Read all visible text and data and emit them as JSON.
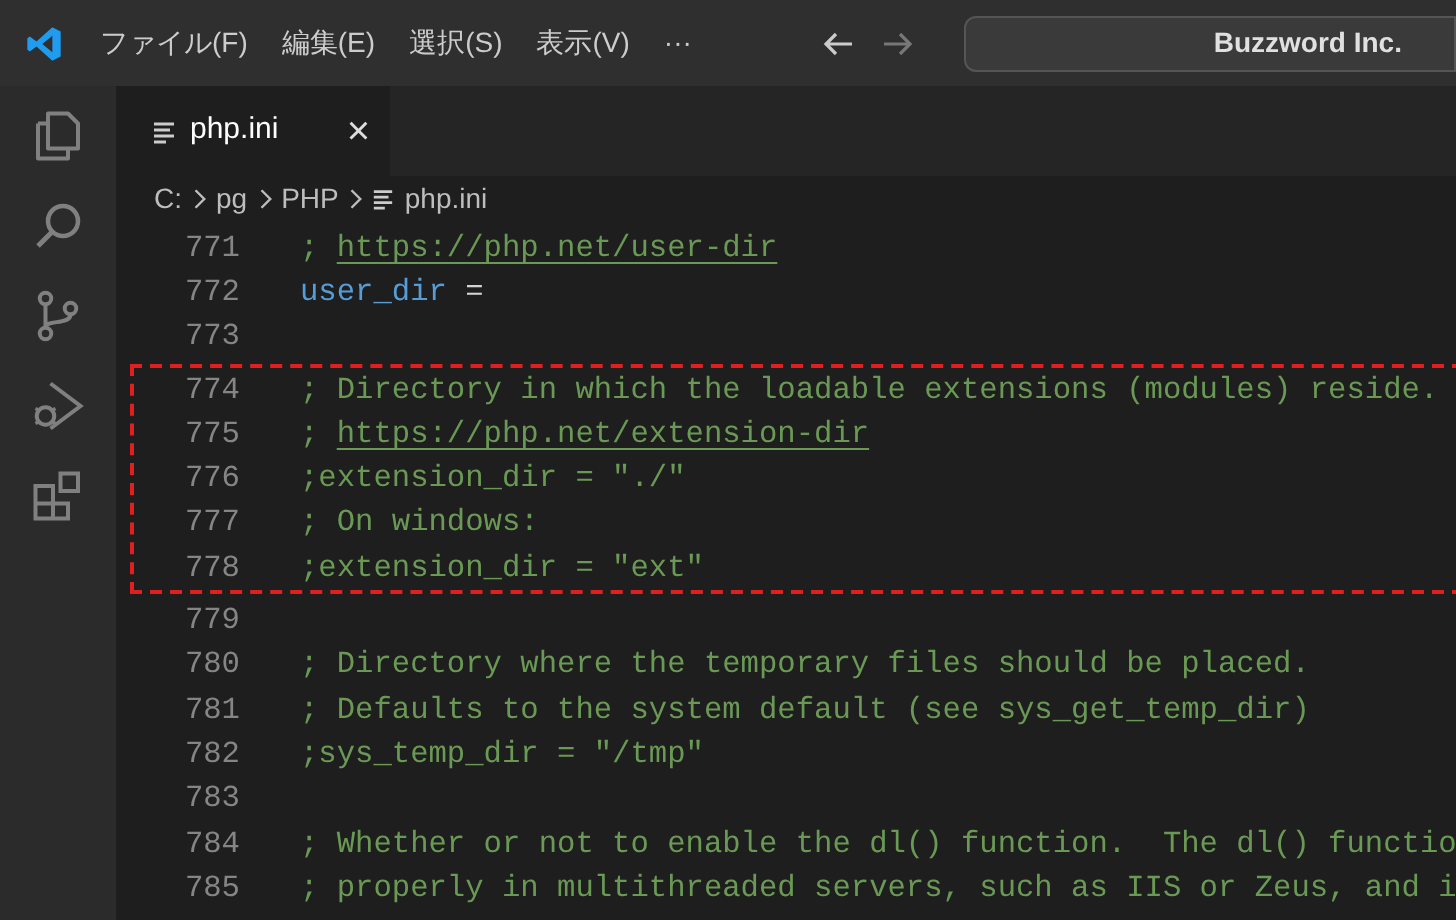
{
  "title_bar": {
    "menus": [
      "ファイル(F)",
      "編集(E)",
      "選択(S)",
      "表示(V)",
      "···"
    ],
    "search": {
      "value": "Buzzword Inc."
    }
  },
  "activity_bar": [
    {
      "kind": "files",
      "selected": false
    },
    {
      "kind": "search",
      "selected": false
    },
    {
      "kind": "source-control",
      "selected": false
    },
    {
      "kind": "run-debug",
      "selected": false
    },
    {
      "kind": "extensions",
      "selected": false
    }
  ],
  "tabs": [
    {
      "label": "php.ini",
      "selected": true,
      "close": "×"
    }
  ],
  "breadcrumb": [
    "C:",
    "pg",
    "PHP",
    "php.ini"
  ],
  "editor": {
    "blocks": [
      {
        "highlighted": false,
        "lines": [
          {
            "number": "771",
            "segments": [
              {
                "kind": "comment",
                "text": "; "
              },
              {
                "kind": "link",
                "text": "https://php.net/user-dir"
              }
            ]
          },
          {
            "number": "772",
            "segments": [
              {
                "kind": "key",
                "text": "user_dir"
              },
              {
                "kind": "plain",
                "text": " ="
              }
            ]
          },
          {
            "number": "773"
          }
        ]
      },
      {
        "highlighted": true,
        "lines": [
          {
            "number": "774",
            "segments": [
              {
                "kind": "comment",
                "text": "; Directory in which the loadable extensions (modules) reside."
              }
            ]
          },
          {
            "number": "775",
            "segments": [
              {
                "kind": "comment",
                "text": "; "
              },
              {
                "kind": "link",
                "text": "https://php.net/extension-dir"
              }
            ]
          },
          {
            "number": "776",
            "segments": [
              {
                "kind": "comment",
                "text": ";extension_dir = \"./\""
              }
            ]
          },
          {
            "number": "777",
            "segments": [
              {
                "kind": "comment",
                "text": "; On windows:"
              }
            ]
          },
          {
            "number": "778",
            "segments": [
              {
                "kind": "comment",
                "text": ";extension_dir = \"ext\""
              }
            ]
          }
        ]
      },
      {
        "highlighted": false,
        "lines": [
          {
            "number": "779"
          },
          {
            "number": "780",
            "segments": [
              {
                "kind": "comment",
                "text": "; Directory where the temporary files should be placed."
              }
            ]
          },
          {
            "number": "781",
            "segments": [
              {
                "kind": "comment",
                "text": "; Defaults to the system default (see sys_get_temp_dir)"
              }
            ]
          },
          {
            "number": "782",
            "segments": [
              {
                "kind": "comment",
                "text": ";sys_temp_dir = \"/tmp\""
              }
            ]
          },
          {
            "number": "783"
          },
          {
            "number": "784",
            "segments": [
              {
                "kind": "comment",
                "text": "; Whether or not to enable the dl() function.  The dl() functio"
              }
            ]
          },
          {
            "number": "785",
            "segments": [
              {
                "kind": "comment",
                "text": "; properly in multithreaded servers, such as IIS or Zeus, and i"
              }
            ]
          }
        ]
      }
    ]
  }
}
